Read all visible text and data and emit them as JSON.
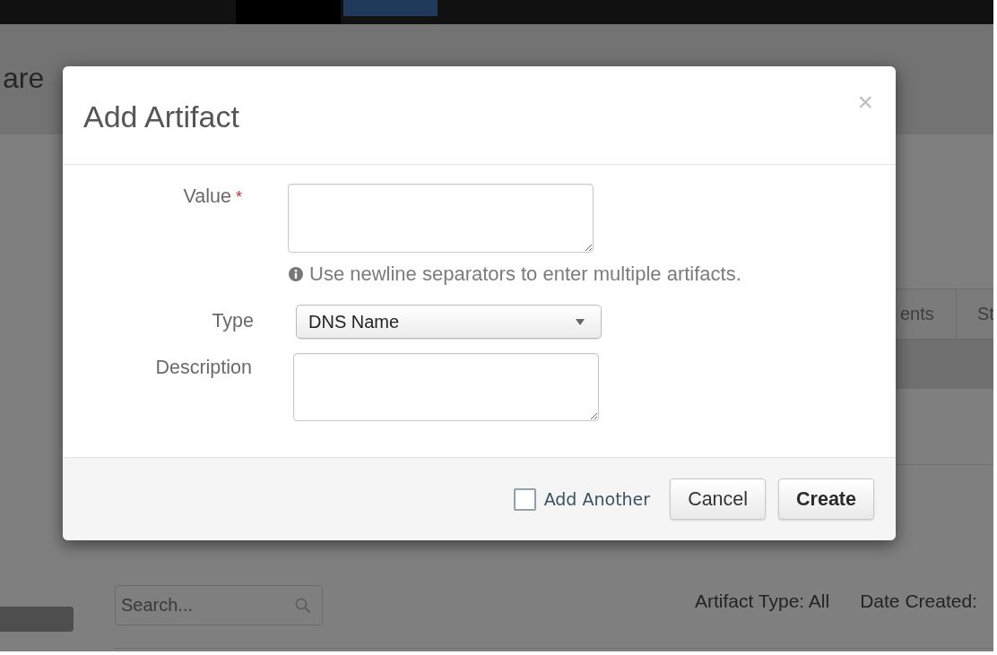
{
  "top_nav": {
    "items": [
      {
        "kind": "tab",
        "selected": true
      },
      {
        "kind": "button"
      }
    ]
  },
  "page_title": "are",
  "tabs": [
    {
      "label": "ents",
      "selected": false
    },
    {
      "label": "St",
      "selected": false
    }
  ],
  "toolbar": {
    "search": {
      "placeholder": "Search..."
    },
    "filters": [
      "Artifact Type: All",
      "Date Created:"
    ]
  },
  "dialog": {
    "title": "Add Artifact",
    "close": "×",
    "required_mark": "*",
    "fields": [
      {
        "kind": "textarea",
        "label": "Value",
        "required": true,
        "help": "Use newline separators to enter multiple artifacts."
      },
      {
        "kind": "select",
        "label": "Type",
        "required": false,
        "value": "DNS Name"
      },
      {
        "kind": "textarea",
        "label": "Description",
        "required": false
      }
    ],
    "add_another": {
      "label": "Add Another",
      "checked": false
    },
    "buttons": [
      {
        "label": "Cancel",
        "kind": "default"
      },
      {
        "label": "Create",
        "kind": "primary"
      }
    ]
  }
}
